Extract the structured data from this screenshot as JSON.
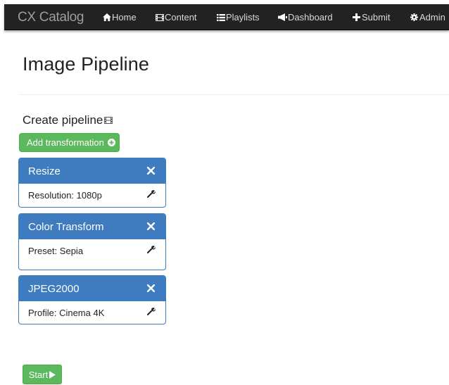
{
  "navbar": {
    "brand": "CX Catalog",
    "links": [
      {
        "label": "Home",
        "icon": "home-icon"
      },
      {
        "label": "Content",
        "icon": "film-icon"
      },
      {
        "label": "Playlists",
        "icon": "list-icon"
      },
      {
        "label": "Dashboard",
        "icon": "bullhorn-icon"
      },
      {
        "label": "Submit",
        "icon": "plus-icon"
      },
      {
        "label": "Admin",
        "icon": "cog-icon"
      }
    ]
  },
  "page": {
    "title": "Image Pipeline",
    "section_title": "Create pipeline",
    "section_icon": "film-icon",
    "add_button_label": "Add transformation",
    "add_button_icon": "plus-circle-icon",
    "start_button_label": "Start",
    "start_button_icon": "play-icon"
  },
  "pipeline": [
    {
      "name": "Resize",
      "setting": "Resolution: 1080p"
    },
    {
      "name": "Color Transform",
      "setting": "Preset: Sepia"
    },
    {
      "name": "JPEG2000",
      "setting": "Profile: Cinema 4K"
    }
  ],
  "colors": {
    "navbar_bg": "#222222",
    "navbar_text": "#d9d9d9",
    "card_header": "#3e7cbf",
    "success_green": "#5cb85c"
  }
}
